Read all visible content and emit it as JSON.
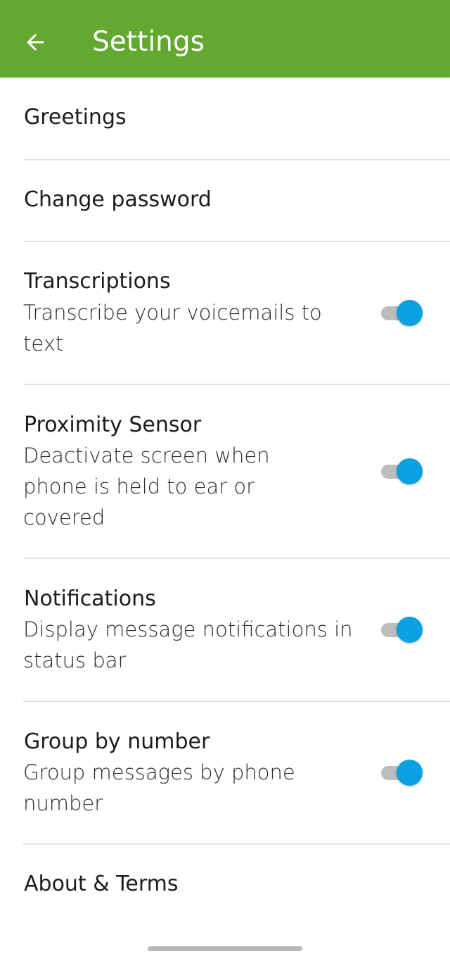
{
  "header": {
    "title": "Settings",
    "back_icon": "arrow-left-icon"
  },
  "colors": {
    "app_bar": "#62a831",
    "toggle_on": "#0aa1e2",
    "toggle_track": "#bdbdbd"
  },
  "settings": {
    "greetings": {
      "title": "Greetings"
    },
    "change_password": {
      "title": "Change password"
    },
    "transcriptions": {
      "title": "Transcriptions",
      "subtitle": "Transcribe your voicemails to text",
      "enabled": true
    },
    "proximity_sensor": {
      "title": "Proximity Sensor",
      "subtitle": "Deactivate screen when phone is held to ear or covered",
      "enabled": true
    },
    "notifications": {
      "title": "Notifications",
      "subtitle": "Display message notifications in status bar",
      "enabled": true
    },
    "group_by_number": {
      "title": "Group by number",
      "subtitle": "Group messages by phone number",
      "enabled": true
    },
    "about_terms": {
      "title": "About & Terms"
    }
  }
}
